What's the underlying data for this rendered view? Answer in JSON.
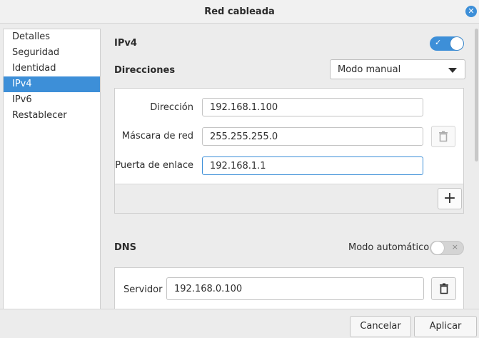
{
  "window": {
    "title": "Red cableada"
  },
  "sidebar": {
    "items": [
      {
        "label": "Detalles"
      },
      {
        "label": "Seguridad"
      },
      {
        "label": "Identidad"
      },
      {
        "label": "IPv4",
        "active": true
      },
      {
        "label": "IPv6"
      },
      {
        "label": "Restablecer"
      }
    ]
  },
  "ipv4": {
    "heading": "IPv4",
    "enabled": true,
    "toggle_symbol": "✓",
    "addresses": {
      "heading": "Direcciones",
      "mode": "Modo manual",
      "address_label": "Dirección",
      "address_value": "192.168.1.100",
      "netmask_label": "Máscara de red",
      "netmask_value": "255.255.255.0",
      "gateway_label": "Puerta de enlace",
      "gateway_value": "192.168.1.1",
      "add_symbol": "+"
    },
    "dns": {
      "heading": "DNS",
      "auto_label": "Modo automático",
      "auto_enabled": false,
      "toggle_symbol": "×",
      "server_label": "Servidor",
      "server_value": "192.168.0.100"
    }
  },
  "footer": {
    "cancel_label": "Cancelar",
    "apply_label": "Aplicar"
  },
  "colors": {
    "accent": "#3d8fd8"
  }
}
